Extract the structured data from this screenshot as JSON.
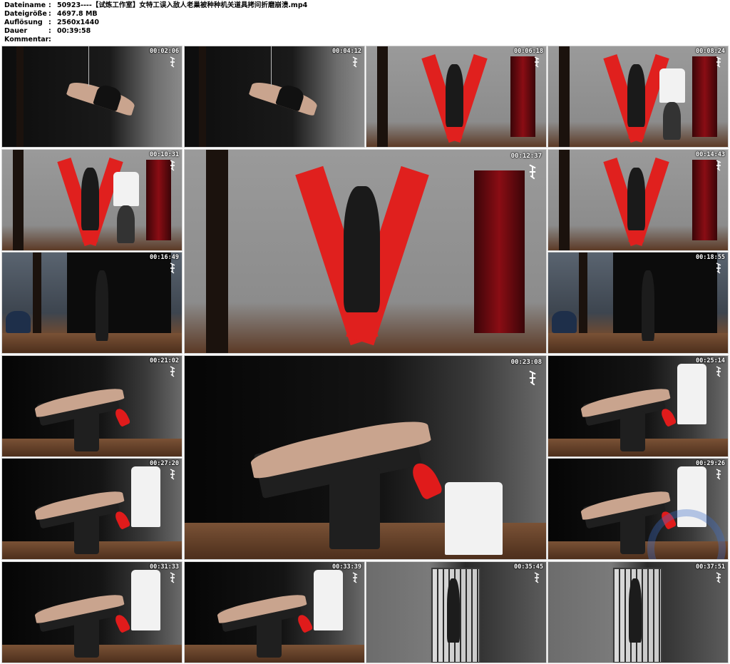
{
  "meta": [
    {
      "key": "Dateiname",
      "value": "50923----【试炼工作室】女特工误入敌人老巢被种种机关道具拷问折磨崩溃.mp4"
    },
    {
      "key": "Dateigröße",
      "value": "4697.8 MB"
    },
    {
      "key": "Auflösung",
      "value": "2560x1440"
    },
    {
      "key": "Dauer",
      "value": "00:39:58"
    },
    {
      "key": "Kommentar",
      "value": ""
    }
  ],
  "meta_sep": ":",
  "thumbs": [
    {
      "time": "00:02:06",
      "scene": "dark-suspension"
    },
    {
      "time": "00:04:12",
      "scene": "dark-suspension"
    },
    {
      "time": "00:06:18",
      "scene": "x-cross-closeup"
    },
    {
      "time": "00:08:24",
      "scene": "x-cross-man"
    },
    {
      "time": "00:10:31",
      "scene": "x-cross-man"
    },
    {
      "time": "00:12:37",
      "scene": "x-cross-large"
    },
    {
      "time": "00:14:43",
      "scene": "x-cross"
    },
    {
      "time": "00:16:49",
      "scene": "room-rope"
    },
    {
      "time": "00:18:55",
      "scene": "room-rope"
    },
    {
      "time": "00:21:02",
      "scene": "chair"
    },
    {
      "time": "00:23:08",
      "scene": "chair-large"
    },
    {
      "time": "00:25:14",
      "scene": "chair-man"
    },
    {
      "time": "00:27:20",
      "scene": "chair-man"
    },
    {
      "time": "00:29:26",
      "scene": "chair-man"
    },
    {
      "time": "00:31:33",
      "scene": "chair-man"
    },
    {
      "time": "00:33:39",
      "scene": "chair-man"
    },
    {
      "time": "00:35:45",
      "scene": "cage"
    },
    {
      "time": "00:37:51",
      "scene": "cage"
    }
  ],
  "colors": {
    "cross": "#e0201e",
    "curtain": "#8a0d14",
    "shoe": "#e01b1b",
    "watermark": "#3c6ec8"
  }
}
